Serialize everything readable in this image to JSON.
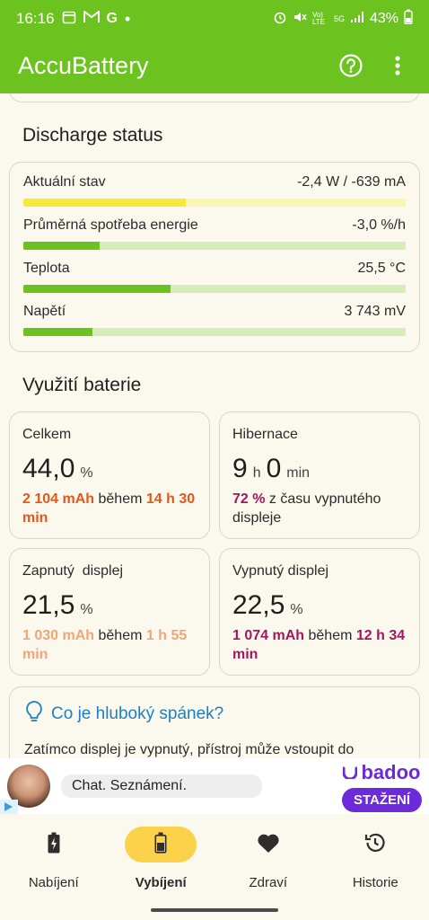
{
  "status_bar": {
    "time": "16:16",
    "notification_icons": [
      "calendar-icon",
      "gmail-icon",
      "google-icon"
    ],
    "right_icons": [
      "alarm-icon",
      "mute-icon",
      "volte-icon",
      "5g-icon",
      "signal-icon"
    ],
    "volte_label": "Vo) LTE",
    "network_label": "5G",
    "battery_percent": "43%",
    "battery_level": 0.43
  },
  "app_bar": {
    "title": "AccuBattery",
    "help_icon": "help-circle-icon",
    "menu_icon": "more-vert-icon"
  },
  "discharge_status": {
    "title": "Discharge status",
    "rows": [
      {
        "label": "Aktuální stav",
        "value": "-2,4 W / -639 mA",
        "fill": 0.425,
        "color": "yellow"
      },
      {
        "label": "Průměrná spotřeba energie",
        "value": "-3,0 %/h",
        "fill": 0.2,
        "color": "green"
      },
      {
        "label": "Teplota",
        "value": "25,5 °C",
        "fill": 0.386,
        "color": "green"
      },
      {
        "label": "Napětí",
        "value": "3 743 mV",
        "fill": 0.18,
        "color": "green"
      }
    ]
  },
  "battery_usage": {
    "title": "Využití baterie",
    "total": {
      "title": "Celkem",
      "value": "44,0",
      "unit": "%",
      "mah": "2 104 mAh",
      "during": "během",
      "duration": "14 h 30 min"
    },
    "hibernation": {
      "title": "Hibernace",
      "hours": "9",
      "h_unit": "h",
      "minutes": "0",
      "m_unit": "min",
      "percent": "72 %",
      "desc": "z času vypnutého displeje"
    },
    "screen_on": {
      "title": "Zapnutý  displej",
      "value": "21,5",
      "unit": "%",
      "mah": "1 030 mAh",
      "during": "během",
      "duration": "1 h 55 min"
    },
    "screen_off": {
      "title": "Vypnutý displej",
      "value": "22,5",
      "unit": "%",
      "mah": "1 074 mAh",
      "during": "během",
      "duration": "12 h 34 min"
    }
  },
  "deep_sleep_tip": {
    "icon": "lightbulb-icon",
    "link": "Co je hluboký spánek?",
    "text": "Zatímco displej je vypnutý, přístroj může vstoupit do"
  },
  "ad": {
    "text": "Chat. Seznámení.",
    "brand": "badoo",
    "cta": "STAŽENÍ"
  },
  "bottom_nav": [
    {
      "label": "Nabíjení",
      "icon": "battery-charging-icon",
      "active": false
    },
    {
      "label": "Vybíjení",
      "icon": "battery-discharging-icon",
      "active": true
    },
    {
      "label": "Zdraví",
      "icon": "heart-icon",
      "active": false
    },
    {
      "label": "Historie",
      "icon": "history-icon",
      "active": false
    }
  ],
  "colors": {
    "primary": "#6cc320",
    "bar_yellow": "#f6e93a",
    "bar_green": "#6cc320",
    "accent_orange": "#e2571c",
    "accent_purple": "#a3175e",
    "nav_active": "#fbd24a",
    "link_blue": "#1e7fc4",
    "badoo_purple": "#6b2bd9"
  }
}
